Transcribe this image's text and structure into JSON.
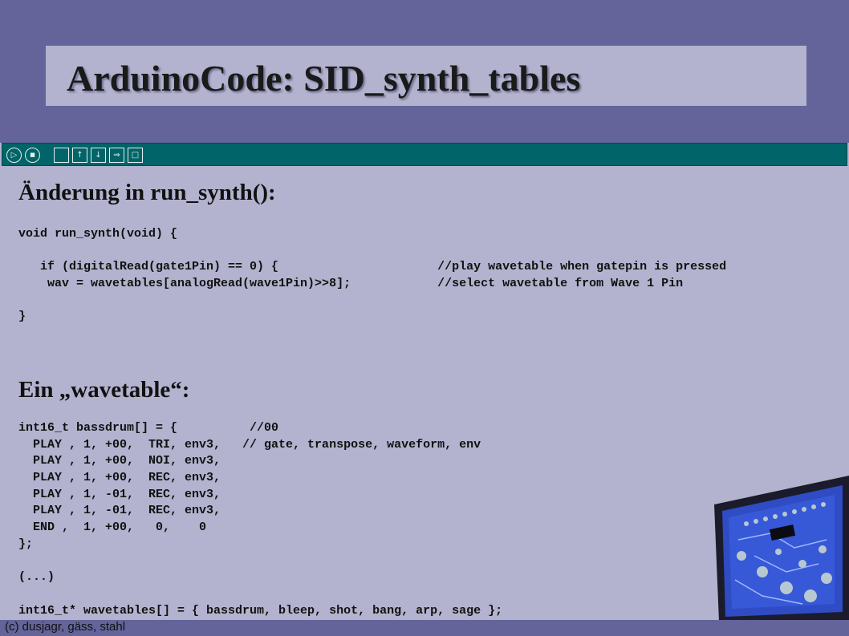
{
  "slide": {
    "title": "ArduinoCode: SID_synth_tables",
    "section1_heading": "Änderung in run_synth():",
    "section2_heading": "Ein „wavetable“:",
    "footer": "(c) dusjagr, gäss, stahl"
  },
  "toolbar": {
    "buttons": [
      {
        "name": "verify-icon",
        "glyph": "▷"
      },
      {
        "name": "stop-icon",
        "glyph": "■"
      },
      {
        "name": "new-file-icon",
        "glyph": ""
      },
      {
        "name": "open-icon",
        "glyph": "↑"
      },
      {
        "name": "save-icon",
        "glyph": "↓"
      },
      {
        "name": "upload-icon",
        "glyph": "⇒"
      },
      {
        "name": "serial-monitor-icon",
        "glyph": "□"
      }
    ]
  },
  "code1": [
    "void run_synth(void) {",
    "",
    "   if (digitalRead(gate1Pin) == 0) {                      //play wavetable when gatepin is pressed",
    "    wav = wavetables[analogRead(wave1Pin)>>8];            //select wavetable from Wave 1 Pin",
    "",
    "}"
  ],
  "code2": [
    "int16_t bassdrum[] = {          //00",
    "  PLAY , 1, +00,  TRI, env3,   // gate, transpose, waveform, env",
    "  PLAY , 1, +00,  NOI, env3,",
    "  PLAY , 1, +00,  REC, env3,",
    "  PLAY , 1, -01,  REC, env3,",
    "  PLAY , 1, -01,  REC, env3,",
    "  END ,  1, +00,   0,    0",
    "};",
    "",
    "(...)",
    "",
    "int16_t* wavetables[] = { bassdrum, bleep, shot, bang, arp, sage };"
  ]
}
